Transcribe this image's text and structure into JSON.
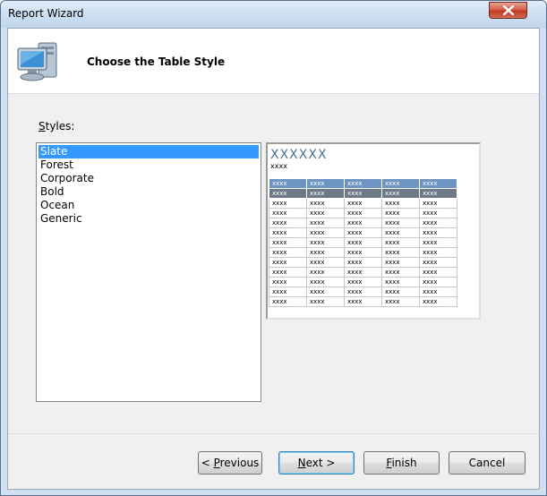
{
  "window": {
    "title": "Report Wizard"
  },
  "header": {
    "title": "Choose the Table Style",
    "icon": "computer-icon"
  },
  "styles": {
    "label_accel": "S",
    "label_rest": "tyles:",
    "items": [
      "Slate",
      "Forest",
      "Corporate",
      "Bold",
      "Ocean",
      "Generic"
    ],
    "selected": "Slate"
  },
  "preview": {
    "title": "XXXXXX",
    "subtitle": "xxxx",
    "cell": "xxxx",
    "header_color": "#6e95c2",
    "highlight_color": "#6d7a86",
    "title_color": "#4a7090"
  },
  "buttons": {
    "previous": {
      "prefix": "< ",
      "accel": "P",
      "rest": "revious"
    },
    "next": {
      "prefix": "",
      "accel": "N",
      "rest": "ext >"
    },
    "finish": {
      "prefix": "",
      "accel": "F",
      "rest": "inish"
    },
    "cancel": {
      "label": "Cancel"
    }
  },
  "colors": {
    "selection": "#3399ff",
    "close_button": "#c23b22"
  }
}
